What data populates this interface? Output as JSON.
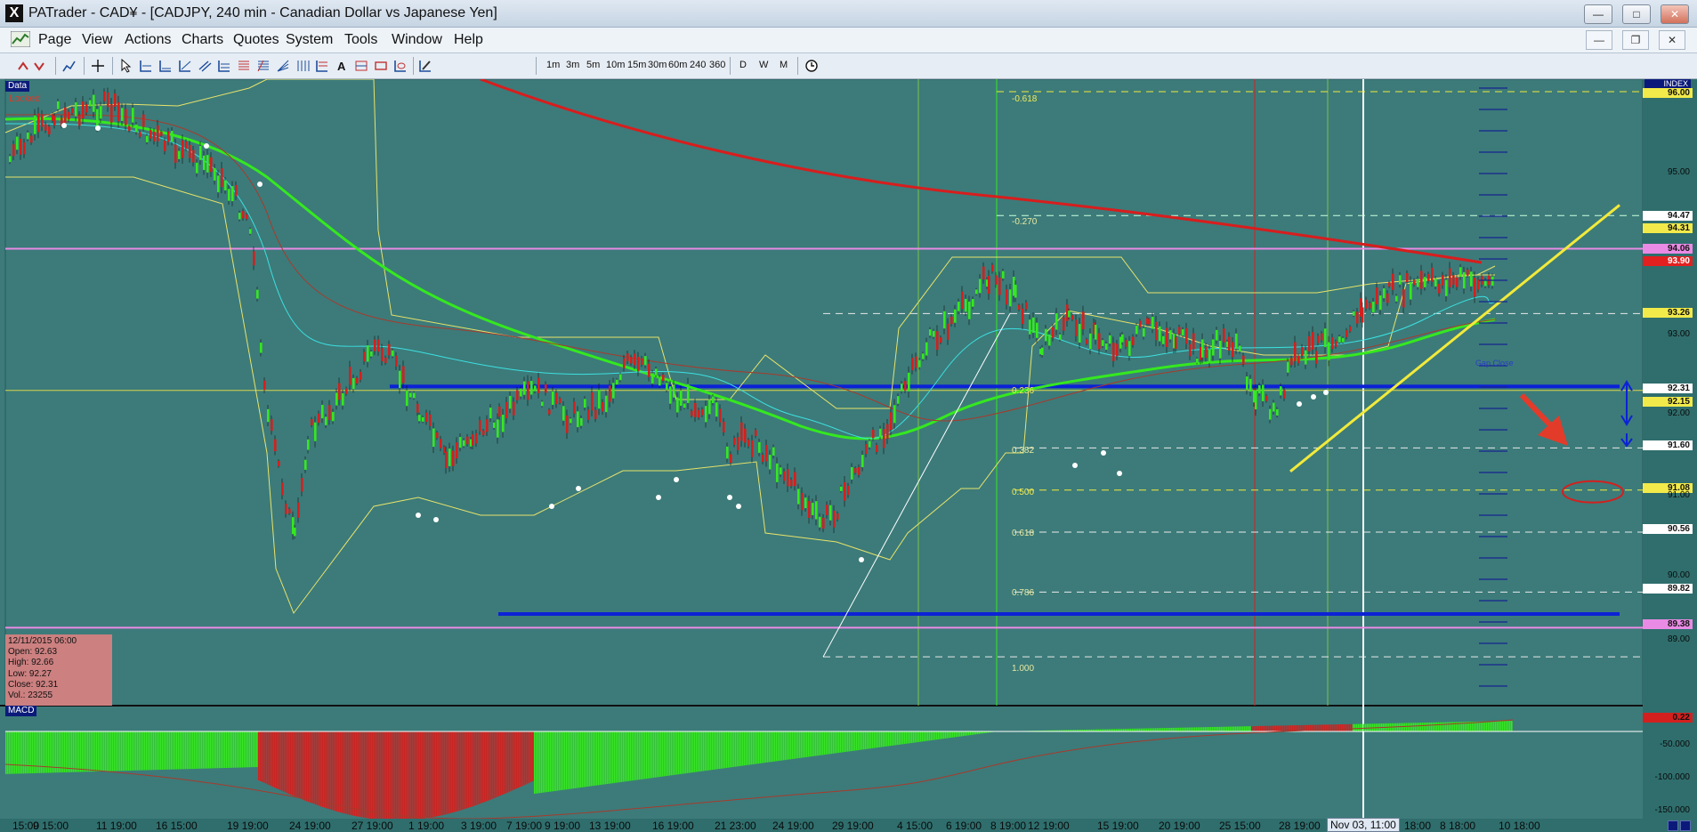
{
  "window": {
    "title": "PATrader - CAD¥ - [CADJPY, 240 min - Canadian Dollar vs Japanese Yen]",
    "logo": "X"
  },
  "menu": [
    "Page",
    "View",
    "Actions",
    "Charts",
    "Quotes",
    "System",
    "Tools",
    "Window",
    "Help"
  ],
  "toolbar": {
    "timeframes": [
      "1m",
      "3m",
      "5m",
      "10m",
      "15m",
      "30m",
      "60m",
      "240",
      "360"
    ],
    "periods": [
      "D",
      "W",
      "M"
    ]
  },
  "chart": {
    "data_tag": "Data",
    "locked_tag": "Locked",
    "index_tag": "INDEX",
    "macd_tag": "MACD",
    "info": {
      "date": "12/11/2015 06:00",
      "open": "Open: 92.63",
      "high": "High: 92.66",
      "low": "Low: 92.27",
      "close": "Close: 92.31",
      "vol": "Vol.: 23255"
    },
    "fib_labels": [
      "-0.618",
      "-0.270",
      "0.236",
      "0.382",
      "0.500",
      "0.618",
      "0.786",
      "1.000"
    ],
    "annotation": "Gap Close",
    "price_labels": [
      {
        "text": "96.00",
        "color": "#f2ea4a"
      },
      {
        "text": "94.47",
        "color": "#ffffff"
      },
      {
        "text": "94.31",
        "color": "#f2ea4a"
      },
      {
        "text": "94.06",
        "color": "#e98be4"
      },
      {
        "text": "93.90",
        "color": "#e32020"
      },
      {
        "text": "93.26",
        "color": "#f2ea4a"
      },
      {
        "text": "92.31",
        "color": "#ffffff"
      },
      {
        "text": "92.15",
        "color": "#f2ea4a"
      },
      {
        "text": "91.60",
        "color": "#ffffff"
      },
      {
        "text": "91.08",
        "color": "#f2ea4a"
      },
      {
        "text": "90.56",
        "color": "#ffffff"
      },
      {
        "text": "89.82",
        "color": "#ffffff"
      },
      {
        "text": "89.38",
        "color": "#e98be4"
      }
    ],
    "price_axis": [
      "95.00",
      "93.00",
      "92.00",
      "91.00",
      "90.00",
      "89.00"
    ],
    "macd_axis": [
      "0.22",
      "-50.000",
      "-100.000",
      "-150.000"
    ],
    "time_labels": [
      "15:00",
      "9 15:00",
      "11 19:00",
      "16 15:00",
      "19 19:00",
      "24 19:00",
      "27 19:00",
      "1 19:00",
      "3 19:00",
      "7 19:00",
      "9 19:00",
      "13 19:00",
      "16 19:00",
      "21 23:00",
      "24 19:00",
      "29 19:00",
      "4 15:00",
      "6 19:00",
      "8 19:00",
      "12 19:00",
      "15 19:00",
      "20 19:00",
      "25 15:00",
      "28 19:00",
      "Nov 03, 11:00",
      "18:00",
      "8 18:00",
      "10 18:00"
    ],
    "colors": {
      "background": "#3c7b7a",
      "bull": "#35e81f",
      "bear": "#d3201e",
      "support": "#0c22d6",
      "trend": "#f2ea3a",
      "ma200": "#d81d1d"
    }
  }
}
